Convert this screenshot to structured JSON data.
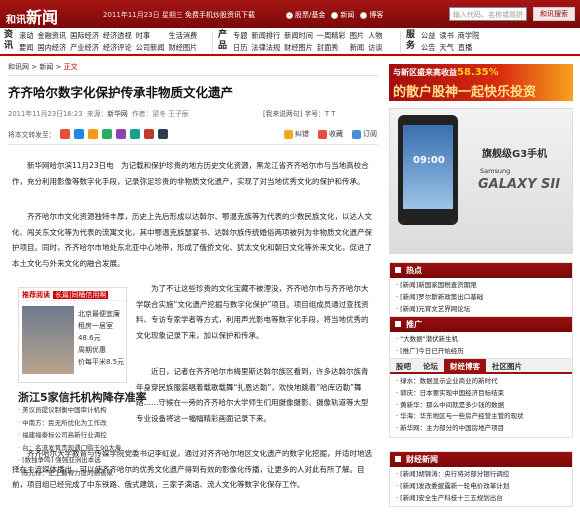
{
  "topbar": {
    "logo_main": "和讯",
    "logo_sub": "新闻",
    "date": "2011年11月23日 星期三",
    "promo": "免费手机炒股资讯下载",
    "radios": [
      {
        "label": "股票/基金",
        "checked": true
      },
      {
        "label": "新闻",
        "checked": false
      },
      {
        "label": "博客",
        "checked": false
      }
    ],
    "search_placeholder": "输入代码、名称或简拼",
    "search_button": "和讯搜索"
  },
  "nav": {
    "groups": [
      {
        "title": "资讯",
        "links": [
          "滚动",
          "要闻",
          "金融资讯",
          "国内经济",
          "国际经济",
          "产业经济",
          "经济透视",
          "经济评论",
          "时事",
          "公司新闻",
          "生活消费",
          "财经图片"
        ]
      },
      {
        "title": "产品",
        "links": [
          "专题",
          "日历",
          "新闻排行",
          "法律法规",
          "新闻时间",
          "财经图片",
          "一周精彩",
          "封面秀",
          "图片",
          "新闻",
          "人物",
          "访谈"
        ]
      },
      {
        "title": "服务",
        "links": [
          "公益",
          "公告",
          "读书",
          "天气",
          "商学院",
          "直播"
        ]
      }
    ]
  },
  "breadcrumb": {
    "items": [
      "和讯网",
      "新闻",
      "正文"
    ]
  },
  "article": {
    "title": "齐齐哈尔数字化保护传承非物质文化遗产",
    "time": "2011年11月23日16:23",
    "source_label": "来源：",
    "source": "新华网",
    "author_label": "作者：",
    "author": "梁冬 王子辰",
    "tools": "[我来说两句] 字号：T T",
    "share_label": "将本文转发至：",
    "actions": [
      "纠错",
      "收藏",
      "订阅"
    ],
    "paragraphs": [
      "新华网哈尔滨11月23日电　为记载和保护珍贵的地方历史文化资源，黑龙江省齐齐哈尔市与当地高校合作，充分利用影像等数字化手段，记录弥足珍贵的非物质文化遗产，实现了对当地优秀文化的保护和传承。",
      "齐齐哈尔市文化资源独特丰厚，历史上先后形成以达斡尔、鄂温克族等为代表的少数民族文化，以达人文化、闯关东文化等为代表的流寓文化，其中鄂温克族瑟宴书、达斡尔族传统婚俗两项被列为非物质文化遗产保护项目。同时，齐齐哈尔市地处东北亚中心地带，形成了俄侨文化、犹太文化和朝日文化等外来文化，促进了本土文化与外来文化的融合发展。",
      "为了不让这些珍贵的文化宝藏不被湮没，齐齐哈尔市与齐齐哈尔大学联合实施“文化遗产挖掘与数字化保护”项目。项目组成员通过查找资料、专访专家学者等方式，利用声光影电等数字化手段，将当地优秀的文化现象记录下来，加以保护和传承。",
      "近日，记者在齐齐哈尔市梅里斯达斡尔族区看到，许多达斡尔族青年身穿民族服装唱着载歌载舞“扎恩达勒”，欢快地跳着“哈库迈勒”舞蹈……守候在一旁的齐齐哈尔大学师生们用摄像摄影、摄像轨道等大型专业设备将这一幅幅精彩画面记录下来。",
      "齐齐哈尔大学教育与传媒学院党委书记李虹说，通过对齐齐哈尔地区文化遗产的数字化挖掘，并适时地选择在主流媒体播出，可以使齐齐哈尔的优秀文化遗产得到有效的影像化传播，让更多的人对此有所了解。目前，项目组已经完成了中东铁路、俄式建筑，三家子满语、流人文化等数字化保存工作。"
    ]
  },
  "inline_ad": {
    "head": "推荐阅读",
    "tag": "长篇|同桶信用啊",
    "lines": [
      "北京最便宜廉",
      "租房一居室",
      "48.6元",
      "周期优惠",
      "价每平米8.5元"
    ]
  },
  "recommend": {
    "title": "浙江5家信托机构降存准率",
    "items": [
      "美议员提议制衡中国审计机构",
      "中南方：民无所优化为工作改",
      "福建福泰标公司高新行业调控",
      "台：名流发育贵现遇门购王90大寿",
      "[数独争鸣] 强强亚洲出本选",
      "陈光标：史上最有力度的慈善家"
    ]
  },
  "sidebar": {
    "banner_line1": "与新区盛来高收益",
    "banner_pct": "58.35%",
    "banner_line2": "的散户股神一起快乐投资",
    "phone_time": "09:00",
    "phone_name": "旗舰级G3手机",
    "phone_brand": "Samsung",
    "phone_model": "GALAXY SII",
    "hot_title": "热点",
    "hot": [
      "[新闻]新国家国税查货期限",
      "[新闻]罗尔斯新政策出口基础",
      "[新闻]元宵文艺界网论坛",
      "[新闻]第六届上海保险论坛"
    ],
    "rec_title": "推广",
    "rec": [
      "\"大数据\"潜伏新生机",
      "[推广]今日已开始经历",
      "[推广]今日已开始经历"
    ],
    "tabs": [
      "股吧",
      "论坛",
      "财经博客",
      "社区图片"
    ],
    "tab_active": 2,
    "tab_items": [
      "绿水：数据显示企业商业的新时代",
      "郭庆：日本要实现中国经济目标结束",
      "黄新华：那么中间就是多少钱的数据",
      "华海：华东地区与一些房产经营主管的现状",
      "新华网：主力部分的中国房地产项目"
    ],
    "fin_title": "财经新闻",
    "fin": [
      "[新闻]胡锦涛：央行将对部分银行调控",
      "[新闻]发改委披露新一轮电价改革计划",
      "[新闻]安全生产科技十三五规划出台"
    ]
  }
}
